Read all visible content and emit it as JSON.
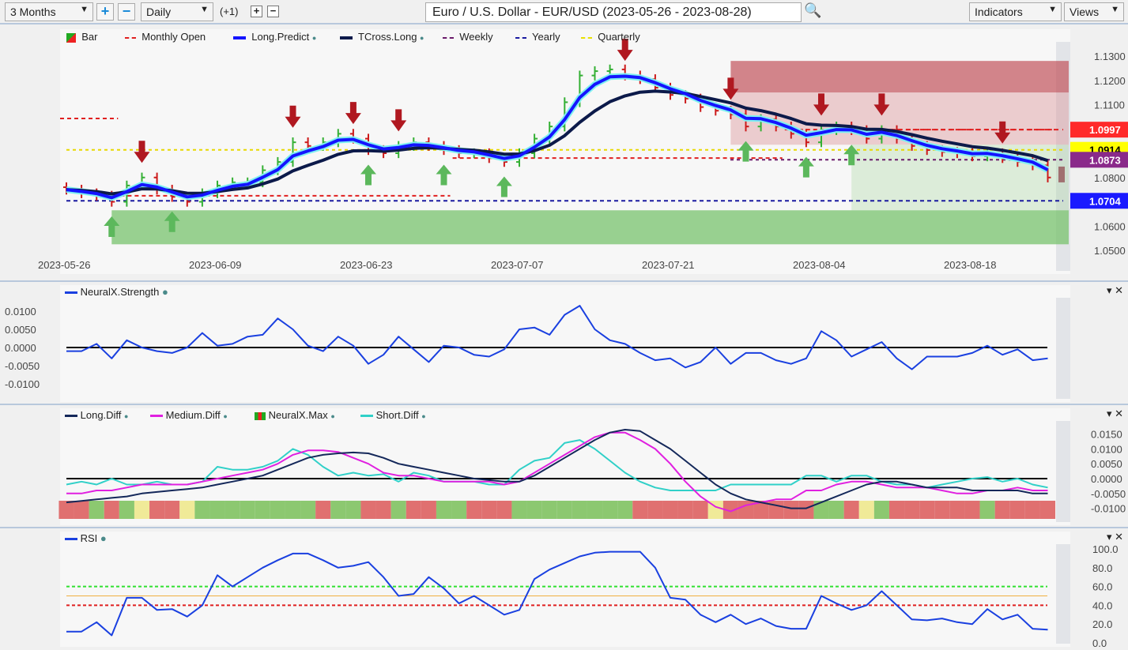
{
  "toolbar": {
    "range": "3 Months",
    "interval": "Daily",
    "offset": "(+1)",
    "title": "Euro / U.S. Dollar - EUR/USD (2023-05-26 - 2023-08-28)",
    "indicators": "Indicators",
    "views": "Views"
  },
  "legend_main": [
    "Bar",
    "Monthly Open",
    "Long.Predict",
    "TCross.Long",
    "Weekly",
    "Yearly",
    "Quarterly"
  ],
  "colors": {
    "up": "#34b034",
    "down": "#cc1a1a",
    "long_predict": "#1414ff",
    "tcross": "#0c1a4a",
    "monthly": "#e02020",
    "weekly": "#6a1a6a",
    "yearly": "#1a1aa0",
    "quarterly": "#e8e000",
    "long_diff": "#14285a",
    "medium_diff": "#e020e0",
    "short_diff": "#30d0c8",
    "rsi": "#1a40e0"
  },
  "chart_data": [
    {
      "type": "ohlc",
      "pane": "price",
      "ylim": [
        1.05,
        1.135
      ],
      "y_ticks": [
        "1.1300",
        "1.1200",
        "1.1100",
        "1.0800",
        "1.0600",
        "1.0500"
      ],
      "x_ticks": [
        "2023-05-26",
        "2023-06-09",
        "2023-06-23",
        "2023-07-07",
        "2023-07-21",
        "2023-08-04",
        "2023-08-18"
      ],
      "close": [
        1.075,
        1.0735,
        1.0725,
        1.07,
        1.0767,
        1.08,
        1.075,
        1.072,
        1.07,
        1.0735,
        1.0767,
        1.078,
        1.078,
        1.083,
        1.0864,
        1.0945,
        1.093,
        1.0945,
        1.098,
        1.096,
        1.0913,
        1.09,
        1.093,
        1.0945,
        1.093,
        1.0913,
        1.09,
        1.09,
        1.088,
        1.0864,
        1.09,
        1.096,
        1.101,
        1.111,
        1.122,
        1.1238,
        1.1245,
        1.122,
        1.1205,
        1.117,
        1.114,
        1.1125,
        1.109,
        1.1075,
        1.106,
        1.101,
        1.104,
        1.101,
        1.098,
        1.0945,
        1.0995,
        1.101,
        1.0995,
        1.096,
        1.0995,
        1.096,
        1.093,
        1.0913,
        1.0905,
        1.09,
        1.0887,
        1.09,
        1.088,
        1.0864,
        1.085,
        1.08
      ],
      "levels": [
        {
          "name": "Monthly Open",
          "value": "1.0997",
          "color": "#ff2a2a"
        },
        {
          "name": "Quarterly",
          "value": "1.0914",
          "color": "#ffff00"
        },
        {
          "name": "Weekly",
          "value": "1.0873",
          "color": "#8a2a8a"
        },
        {
          "name": "Yearly",
          "value": "1.0704",
          "color": "#1a1aff"
        }
      ],
      "monthly_open_steps": [
        [
          0,
          3,
          1.1043
        ],
        [
          4,
          25,
          1.0725
        ],
        [
          26,
          47,
          1.088
        ],
        [
          48,
          65,
          1.0997
        ]
      ],
      "sell_signals": [
        5,
        15,
        19,
        22,
        37,
        44,
        50,
        54,
        62
      ],
      "buy_signals": [
        3,
        7,
        20,
        25,
        29,
        45,
        49,
        52
      ],
      "zones": [
        {
          "kind": "resistance",
          "from": 44,
          "top": 1.128,
          "bottom": 1.115
        },
        {
          "kind": "resistance-light",
          "from": 44,
          "top": 1.115,
          "bottom": 1.0935
        },
        {
          "kind": "support-light",
          "from": 52,
          "top": 1.0935,
          "bottom": 1.0665
        },
        {
          "kind": "support",
          "from": 3,
          "top": 1.0665,
          "bottom": 1.0525
        }
      ]
    },
    {
      "type": "line",
      "pane": "strength",
      "series": [
        {
          "name": "NeuralX.Strength",
          "values": [
            -0.001,
            -0.001,
            0.001,
            -0.003,
            0.002,
            0,
            -0.001,
            -0.0015,
            0,
            0.004,
            0.0005,
            0.001,
            0.003,
            0.0035,
            0.008,
            0.005,
            0.0005,
            -0.001,
            0.003,
            0.0005,
            -0.0045,
            -0.002,
            0.003,
            -0.0005,
            -0.004,
            0.0005,
            0,
            -0.002,
            -0.0025,
            -0.0005,
            0.005,
            0.0055,
            0.0035,
            0.009,
            0.0115,
            0.005,
            0.002,
            0.001,
            -0.0015,
            -0.0035,
            -0.003,
            -0.0055,
            -0.004,
            0,
            -0.0045,
            -0.0015,
            -0.0015,
            -0.0035,
            -0.0045,
            -0.003,
            0.0045,
            0.002,
            -0.0025,
            -0.0005,
            0.0015,
            -0.003,
            -0.006,
            -0.0025,
            -0.0025,
            -0.0025,
            -0.0015,
            0.0005,
            -0.002,
            -0.0005,
            -0.0035,
            -0.003
          ]
        }
      ],
      "y_ticks": [
        "0.0100",
        "0.0050",
        "0.0000",
        "-0.0050",
        "-0.0100"
      ]
    },
    {
      "type": "line",
      "pane": "diff",
      "y_ticks": [
        "0.0150",
        "0.0100",
        "0.0050",
        "0.0000",
        "-0.0050",
        "-0.0100"
      ],
      "series": [
        {
          "name": "Long.Diff",
          "values": [
            -0.008,
            -0.0075,
            -0.007,
            -0.0065,
            -0.006,
            -0.005,
            -0.0045,
            -0.004,
            -0.0035,
            -0.003,
            -0.002,
            -0.001,
            0,
            0.001,
            0.003,
            0.005,
            0.007,
            0.008,
            0.0085,
            0.0088,
            0.0085,
            0.007,
            0.005,
            0.004,
            0.003,
            0.002,
            0.001,
            0,
            -0.0005,
            -0.001,
            -0.001,
            0.001,
            0.004,
            0.007,
            0.01,
            0.013,
            0.0155,
            0.0165,
            0.016,
            0.013,
            0.01,
            0.006,
            0.002,
            -0.002,
            -0.005,
            -0.007,
            -0.008,
            -0.009,
            -0.01,
            -0.01,
            -0.008,
            -0.006,
            -0.004,
            -0.002,
            -0.001,
            -0.001,
            -0.002,
            -0.003,
            -0.003,
            -0.003,
            -0.004,
            -0.004,
            -0.004,
            -0.004,
            -0.005,
            -0.005
          ]
        },
        {
          "name": "Medium.Diff",
          "values": [
            -0.005,
            -0.005,
            -0.004,
            -0.004,
            -0.003,
            -0.002,
            -0.002,
            -0.002,
            -0.002,
            -0.001,
            0,
            0.001,
            0.002,
            0.003,
            0.005,
            0.008,
            0.0095,
            0.0095,
            0.009,
            0.007,
            0.005,
            0.002,
            0.001,
            0.001,
            0,
            -0.001,
            -0.001,
            -0.001,
            -0.001,
            -0.002,
            -0.001,
            0.002,
            0.005,
            0.008,
            0.011,
            0.014,
            0.0155,
            0.0155,
            0.013,
            0.01,
            0.005,
            -0.001,
            -0.006,
            -0.0095,
            -0.011,
            -0.009,
            -0.008,
            -0.007,
            -0.007,
            -0.004,
            -0.004,
            -0.002,
            -0.001,
            -0.001,
            -0.002,
            -0.003,
            -0.003,
            -0.003,
            -0.004,
            -0.005,
            -0.005,
            -0.004,
            -0.004,
            -0.003,
            -0.004,
            -0.004
          ]
        },
        {
          "name": "NeuralX.Max",
          "states": [
            "down",
            "down",
            "up",
            "down",
            "up",
            "neutral",
            "down",
            "down",
            "neutral",
            "up",
            "up",
            "up",
            "up",
            "up",
            "up",
            "up",
            "up",
            "down",
            "up",
            "up",
            "down",
            "down",
            "up",
            "down",
            "down",
            "up",
            "up",
            "down",
            "down",
            "down",
            "up",
            "up",
            "up",
            "up",
            "up",
            "up",
            "up",
            "up",
            "down",
            "down",
            "down",
            "down",
            "down",
            "neutral",
            "down",
            "down",
            "down",
            "down",
            "down",
            "down",
            "up",
            "up",
            "down",
            "neutral",
            "up",
            "down",
            "down",
            "down",
            "down",
            "down",
            "down",
            "up",
            "down",
            "down",
            "down",
            "down"
          ]
        },
        {
          "name": "Short.Diff",
          "values": [
            -0.002,
            -0.001,
            -0.002,
            0,
            -0.002,
            -0.002,
            -0.001,
            -0.002,
            -0.002,
            -0.001,
            0.004,
            0.003,
            0.003,
            0.004,
            0.006,
            0.01,
            0.008,
            0.004,
            0.001,
            0.002,
            0.001,
            0.0015,
            -0.001,
            0.002,
            0.001,
            -0.001,
            -0.001,
            -0.001,
            -0.002,
            -0.002,
            0.003,
            0.006,
            0.007,
            0.012,
            0.013,
            0.01,
            0.006,
            0.002,
            -0.001,
            -0.003,
            -0.004,
            -0.004,
            -0.004,
            -0.004,
            -0.002,
            -0.002,
            -0.002,
            -0.002,
            -0.002,
            0.001,
            0.001,
            -0.001,
            0.001,
            0.001,
            -0.001,
            -0.002,
            -0.002,
            -0.003,
            -0.002,
            -0.001,
            0,
            0.0005,
            -0.001,
            0,
            -0.002,
            -0.003
          ]
        }
      ]
    },
    {
      "type": "line",
      "pane": "rsi",
      "y_ticks": [
        "100.0",
        "80.0",
        "60.0",
        "40.0",
        "20.0",
        "0.0"
      ],
      "levels": [
        60,
        50,
        40
      ],
      "series": [
        {
          "name": "RSI",
          "values": [
            12,
            12,
            22,
            8,
            48,
            48,
            35,
            36,
            28,
            40,
            72,
            60,
            70,
            80,
            88,
            95,
            95,
            88,
            80,
            82,
            86,
            70,
            50,
            52,
            70,
            58,
            42,
            50,
            40,
            30,
            35,
            68,
            78,
            85,
            92,
            96,
            97,
            97,
            97,
            80,
            48,
            46,
            30,
            22,
            30,
            20,
            26,
            18,
            15,
            15,
            50,
            42,
            35,
            40,
            55,
            40,
            25,
            24,
            26,
            22,
            20,
            36,
            25,
            30,
            15,
            14
          ]
        }
      ]
    }
  ]
}
